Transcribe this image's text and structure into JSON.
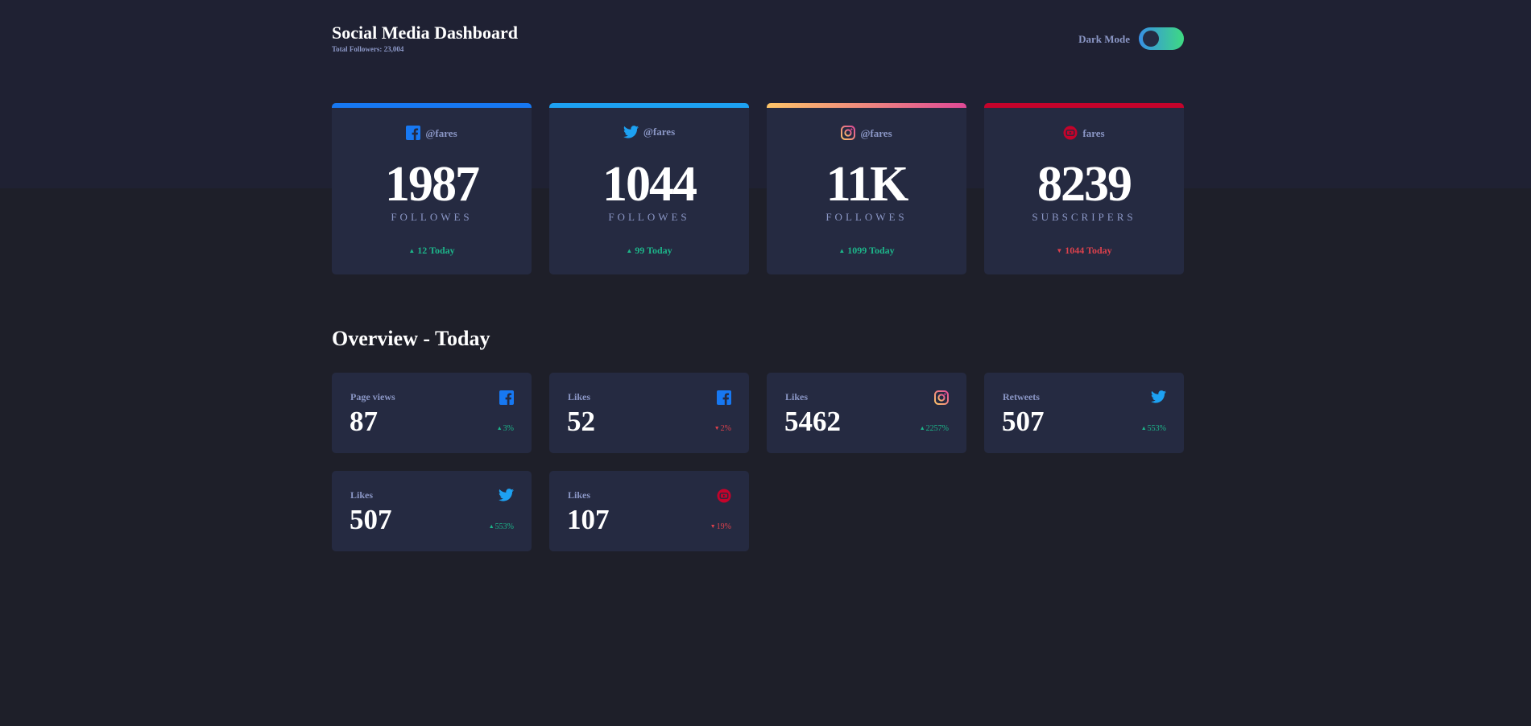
{
  "header": {
    "title": "Social Media Dashboard",
    "subtitle": "Total Followers: 23,004",
    "dark_mode_label": "Dark Mode",
    "dark_mode_on": true
  },
  "colors": {
    "facebook": "#1778f2",
    "twitter": "#1da1f2",
    "instagram": "#fdc468",
    "youtube": "#c4032b",
    "up": "#1db489",
    "down": "#dc414c"
  },
  "cards": [
    {
      "network": "facebook",
      "handle": "@fares",
      "count": "1987",
      "unit": "FOLLOWES",
      "today": "12 Today",
      "trend": "up",
      "arrow": "▲"
    },
    {
      "network": "twitter",
      "handle": "@fares",
      "count": "1044",
      "unit": "FOLLOWES",
      "today": "99 Today",
      "trend": "up",
      "arrow": "▲"
    },
    {
      "network": "instagram",
      "handle": "@fares",
      "count": "11K",
      "unit": "FOLLOWES",
      "today": "1099 Today",
      "trend": "up",
      "arrow": "▲"
    },
    {
      "network": "youtube",
      "handle": "fares",
      "count": "8239",
      "unit": "SUBSCRIPERS",
      "today": "1044 Today",
      "trend": "down",
      "arrow": "▼"
    }
  ],
  "overview": {
    "title": "Overview - Today",
    "items": [
      {
        "label": "Page views",
        "network": "facebook",
        "value": "87",
        "percent": "3%",
        "trend": "up",
        "arrow": "▲"
      },
      {
        "label": "Likes",
        "network": "facebook",
        "value": "52",
        "percent": "2%",
        "trend": "down",
        "arrow": "▼"
      },
      {
        "label": "Likes",
        "network": "instagram",
        "value": "5462",
        "percent": "2257%",
        "trend": "up",
        "arrow": "▲"
      },
      {
        "label": "Retweets",
        "network": "twitter",
        "value": "507",
        "percent": "553%",
        "trend": "up",
        "arrow": "▲"
      },
      {
        "label": "Likes",
        "network": "twitter",
        "value": "507",
        "percent": "553%",
        "trend": "up",
        "arrow": "▲"
      },
      {
        "label": "Likes",
        "network": "youtube",
        "value": "107",
        "percent": "19%",
        "trend": "down",
        "arrow": "▼"
      }
    ]
  }
}
